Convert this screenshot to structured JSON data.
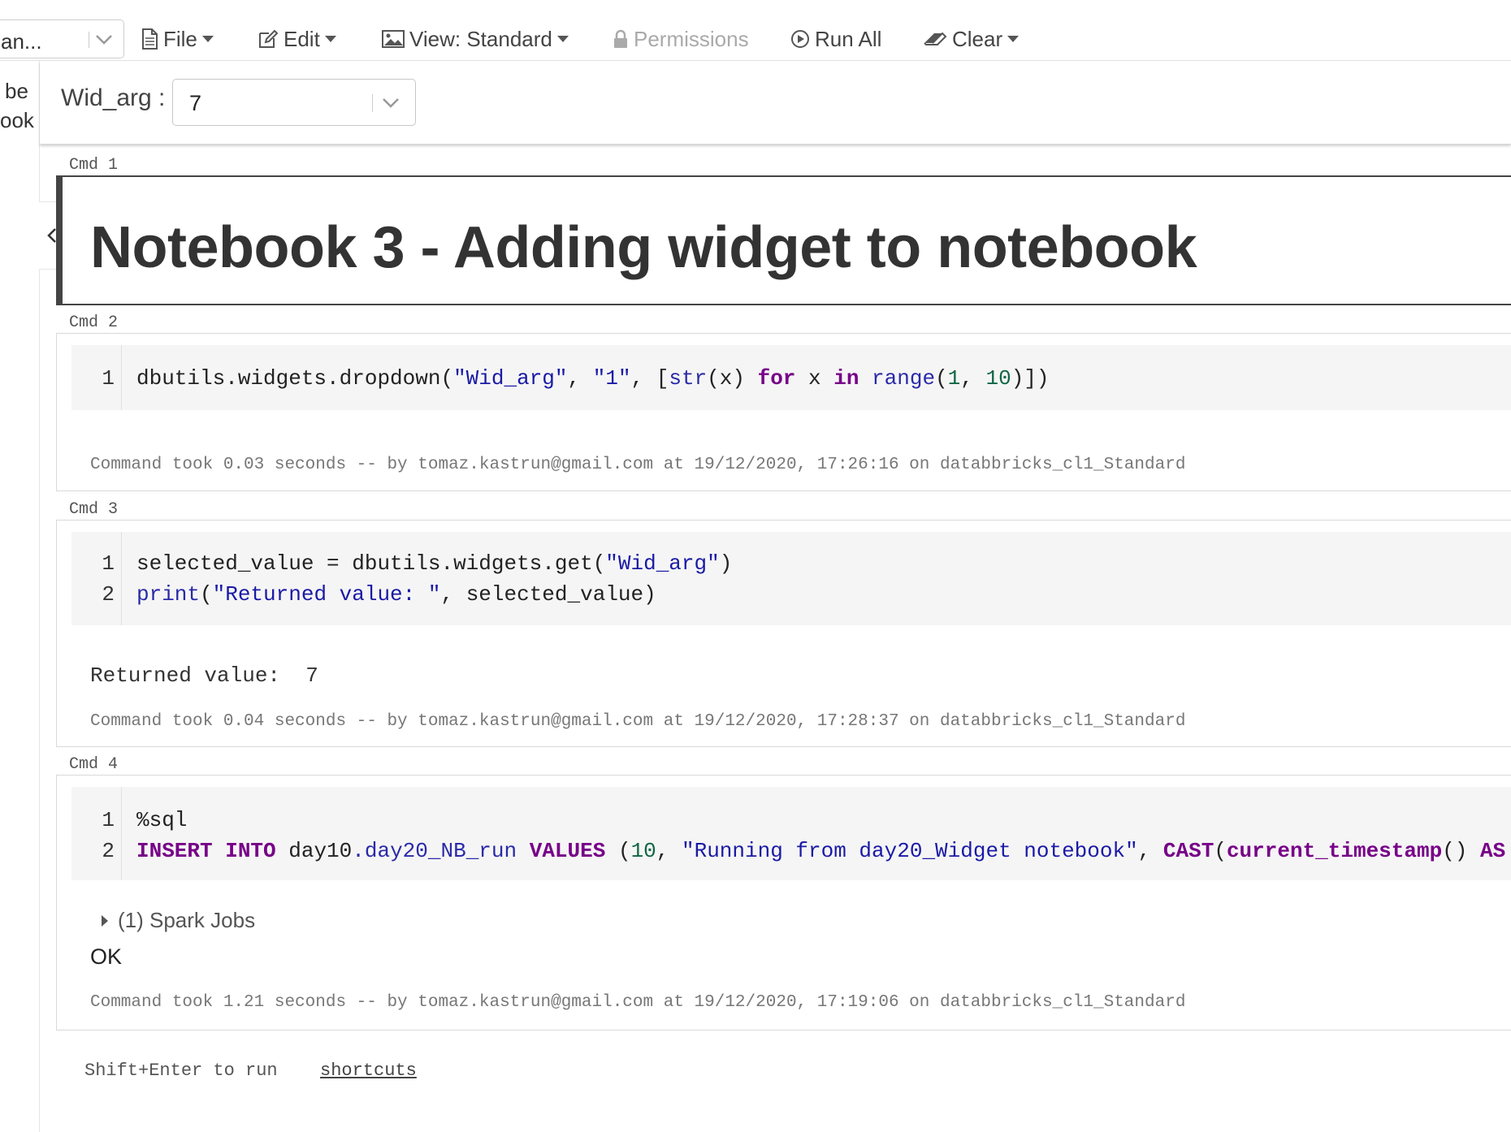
{
  "toolbar": {
    "cluster": {
      "value": "an..."
    },
    "file_label": "File",
    "edit_label": "Edit",
    "view_label": "View: Standard",
    "permissions_label": "Permissions",
    "run_all_label": "Run All",
    "clear_label": "Clear"
  },
  "left_panel": {
    "line1": "be",
    "line2": "ook"
  },
  "widget": {
    "label": "Wid_arg :",
    "value": "7"
  },
  "cells": [
    {
      "cmd": "Cmd 1",
      "title": "Notebook 3 - Adding widget to notebook"
    },
    {
      "cmd": "Cmd 2",
      "line_numbers": [
        "1"
      ],
      "code": {
        "l1_a": "dbutils.widgets.dropdown(",
        "l1_s1": "\"Wid_arg\"",
        "l1_b": ", ",
        "l1_s2": "\"1\"",
        "l1_c": ", [",
        "l1_f1": "str",
        "l1_d": "(x) ",
        "l1_k1": "for",
        "l1_e": " x ",
        "l1_k2": "in",
        "l1_f": " ",
        "l1_f2": "range",
        "l1_g": "(",
        "l1_n1": "1",
        "l1_h": ", ",
        "l1_n2": "10",
        "l1_i": ")])"
      },
      "footer": "Command took 0.03 seconds -- by tomaz.kastrun@gmail.com at 19/12/2020, 17:26:16 on databbricks_cl1_Standard"
    },
    {
      "cmd": "Cmd 3",
      "line_numbers": [
        "1",
        "2"
      ],
      "code": {
        "l1_a": "selected_value = dbutils.widgets.get(",
        "l1_s1": "\"Wid_arg\"",
        "l1_b": ")",
        "l2_f1": "print",
        "l2_a": "(",
        "l2_s1": "\"Returned value: \"",
        "l2_b": ", selected_value)"
      },
      "output": "Returned value:  7",
      "footer": "Command took 0.04 seconds -- by tomaz.kastrun@gmail.com at 19/12/2020, 17:28:37 on databbricks_cl1_Standard"
    },
    {
      "cmd": "Cmd 4",
      "line_numbers": [
        "1",
        "2"
      ],
      "code": {
        "l1": "%sql",
        "l2_k1": "INSERT INTO",
        "l2_a": " day10",
        "l2_f1": ".day20_NB_run",
        "l2_b": " ",
        "l2_k2": "VALUES",
        "l2_c": " (",
        "l2_n1": "10",
        "l2_d": ", ",
        "l2_s1": "\"Running from day20_Widget notebook\"",
        "l2_e": ", ",
        "l2_k3": "CAST",
        "l2_f": "(",
        "l2_k4": "current_timestamp",
        "l2_g": "() ",
        "l2_k5": "AS"
      },
      "spark_jobs": "(1) Spark Jobs",
      "ok": "OK",
      "footer": "Command took 1.21 seconds -- by tomaz.kastrun@gmail.com at 19/12/2020, 17:19:06 on databbricks_cl1_Standard"
    }
  ],
  "bottom": {
    "hint": "Shift+Enter to run",
    "shortcuts": "shortcuts"
  }
}
